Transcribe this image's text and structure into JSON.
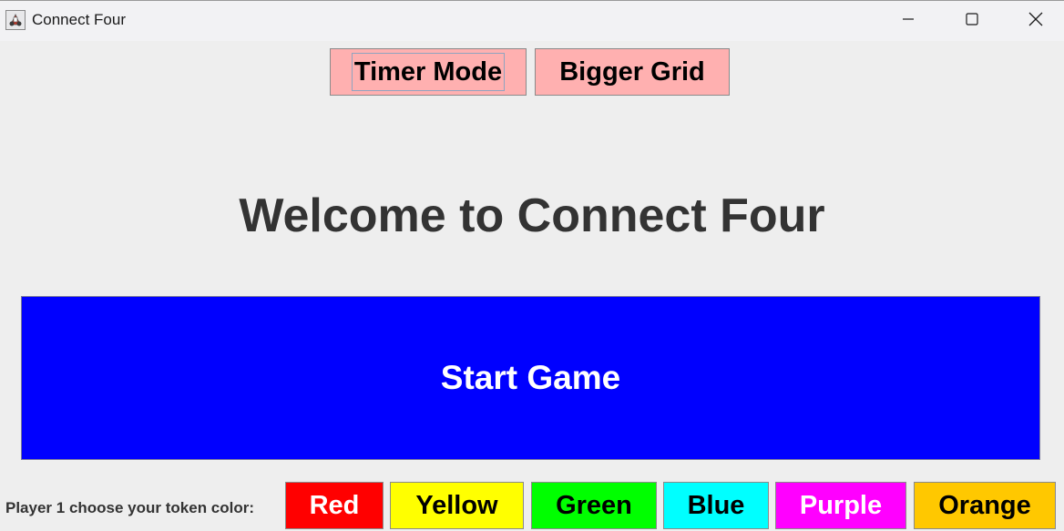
{
  "window": {
    "title": "Connect Four",
    "icons": {
      "app": "java-app-icon",
      "minimize": "minimize-icon",
      "maximize": "maximize-icon",
      "close": "close-icon"
    }
  },
  "modes": {
    "timer_label": "Timer Mode",
    "grid_label": "Bigger Grid",
    "button_color": "#ffb0b0"
  },
  "main": {
    "welcome": "Welcome to Connect Four",
    "start_label": "Start Game",
    "start_color": "#0000ff"
  },
  "token_colors": {
    "prompt": "Player 1 choose your token color:",
    "options": [
      {
        "label": "Red",
        "bg": "#ff0000",
        "fg": "#ffffff"
      },
      {
        "label": "Yellow",
        "bg": "#ffff00",
        "fg": "#000000"
      },
      {
        "label": "Green",
        "bg": "#00ff00",
        "fg": "#000000"
      },
      {
        "label": "Blue",
        "bg": "#00ffff",
        "fg": "#000000"
      },
      {
        "label": "Purple",
        "bg": "#ff00ff",
        "fg": "#ffffff"
      },
      {
        "label": "Orange",
        "bg": "#ffc800",
        "fg": "#000000"
      }
    ]
  }
}
